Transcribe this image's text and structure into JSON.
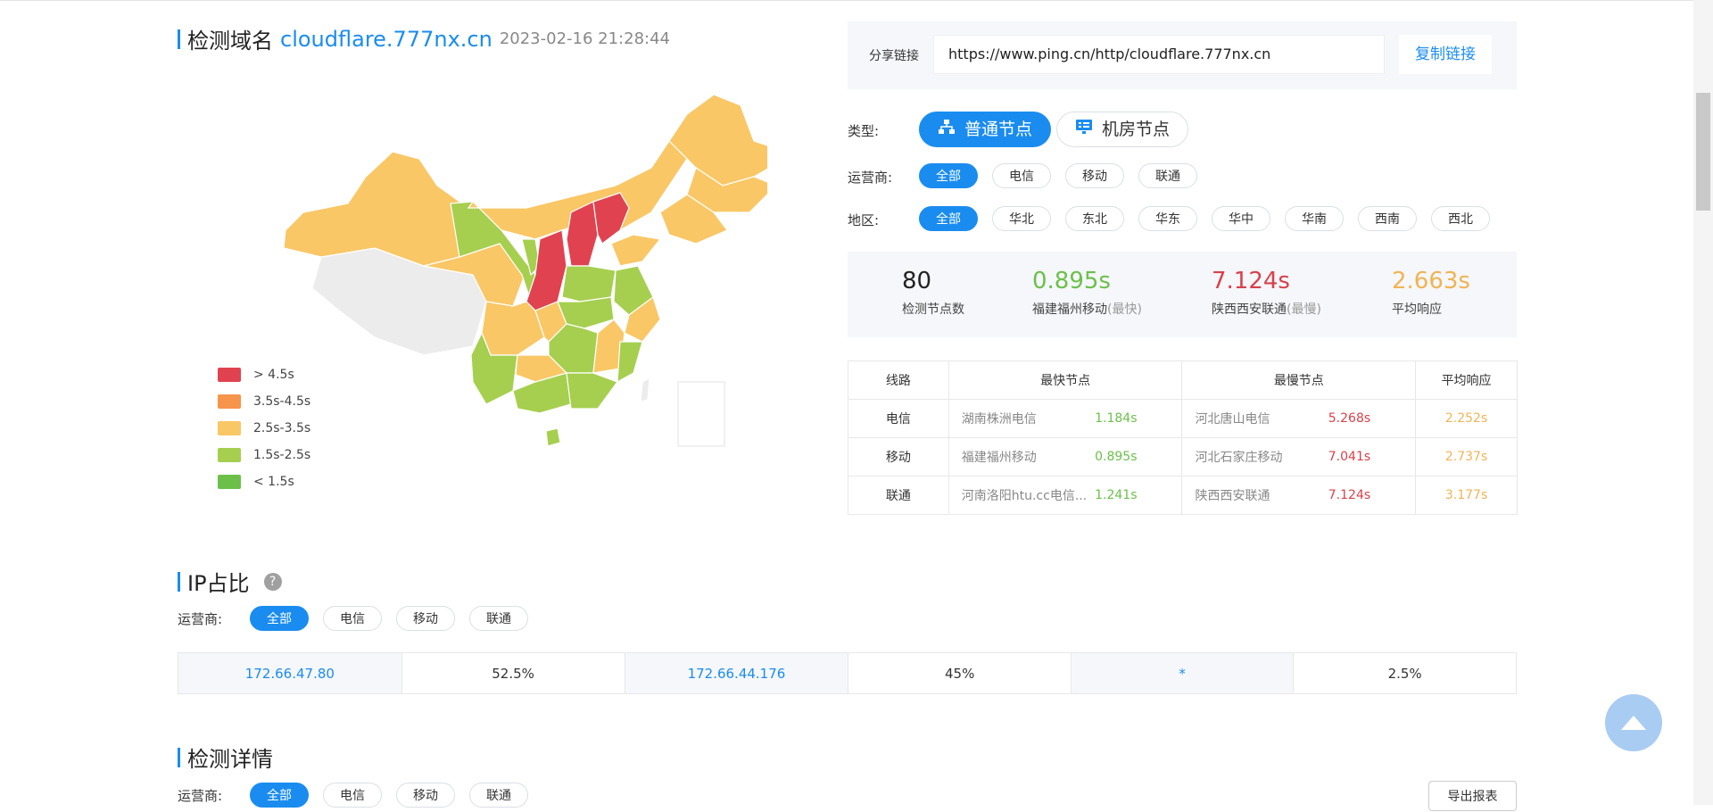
{
  "header": {
    "title_prefix": "检测域名",
    "domain": "cloudflare.777nx.cn",
    "datetime": "2023-02-16 21:28:44"
  },
  "share": {
    "label": "分享链接",
    "url": "https://www.ping.cn/http/cloudflare.777nx.cn",
    "copy_label": "复制链接"
  },
  "filters": {
    "type_label": "类型:",
    "types": [
      "普通节点",
      "机房节点"
    ],
    "isp_label": "运营商:",
    "isps": [
      "全部",
      "电信",
      "移动",
      "联通"
    ],
    "region_label": "地区:",
    "regions": [
      "全部",
      "华北",
      "东北",
      "华东",
      "华中",
      "华南",
      "西南",
      "西北"
    ]
  },
  "stats": {
    "nodes_count": "80",
    "nodes_label": "检测节点数",
    "fastest_value": "0.895s",
    "fastest_label": "福建福州移动",
    "fastest_tag": "(最快)",
    "slowest_value": "7.124s",
    "slowest_label": "陕西西安联通",
    "slowest_tag": "(最慢)",
    "avg_value": "2.663s",
    "avg_label": "平均响应"
  },
  "speed_table": {
    "headers": [
      "线路",
      "最快节点",
      "最慢节点",
      "平均响应"
    ],
    "rows": [
      {
        "line": "电信",
        "fast_node": "湖南株洲电信",
        "fast_time": "1.184s",
        "slow_node": "河北唐山电信",
        "slow_time": "5.268s",
        "avg": "2.252s"
      },
      {
        "line": "移动",
        "fast_node": "福建福州移动",
        "fast_time": "0.895s",
        "slow_node": "河北石家庄移动",
        "slow_time": "7.041s",
        "avg": "2.737s"
      },
      {
        "line": "联通",
        "fast_node": "河南洛阳htu.cc电信...",
        "fast_time": "1.241s",
        "slow_node": "陕西西安联通",
        "slow_time": "7.124s",
        "avg": "3.177s"
      }
    ]
  },
  "legend": [
    {
      "label": "> 4.5s",
      "color": "#e0434f"
    },
    {
      "label": "3.5s-4.5s",
      "color": "#f7944b"
    },
    {
      "label": "2.5s-3.5s",
      "color": "#f9c766"
    },
    {
      "label": "1.5s-2.5s",
      "color": "#a6cf4f"
    },
    {
      "label": "< 1.5s",
      "color": "#6cc04a"
    }
  ],
  "ip_section": {
    "title": "IP占比",
    "isp_label": "运营商:",
    "isps": [
      "全部",
      "电信",
      "移动",
      "联通"
    ],
    "entries": [
      {
        "ip": "172.66.47.80",
        "pct": "52.5%"
      },
      {
        "ip": "172.66.44.176",
        "pct": "45%"
      },
      {
        "ip": "*",
        "pct": "2.5%"
      }
    ]
  },
  "detail_section": {
    "title": "检测详情",
    "isp_label": "运营商:",
    "isps": [
      "全部",
      "电信",
      "移动",
      "联通"
    ],
    "export_label": "导出报表"
  },
  "colors": {
    "accent": "#1a8cf0",
    "fast": "#6cc04a",
    "slow": "#d9414a",
    "avg": "#f0b454"
  }
}
